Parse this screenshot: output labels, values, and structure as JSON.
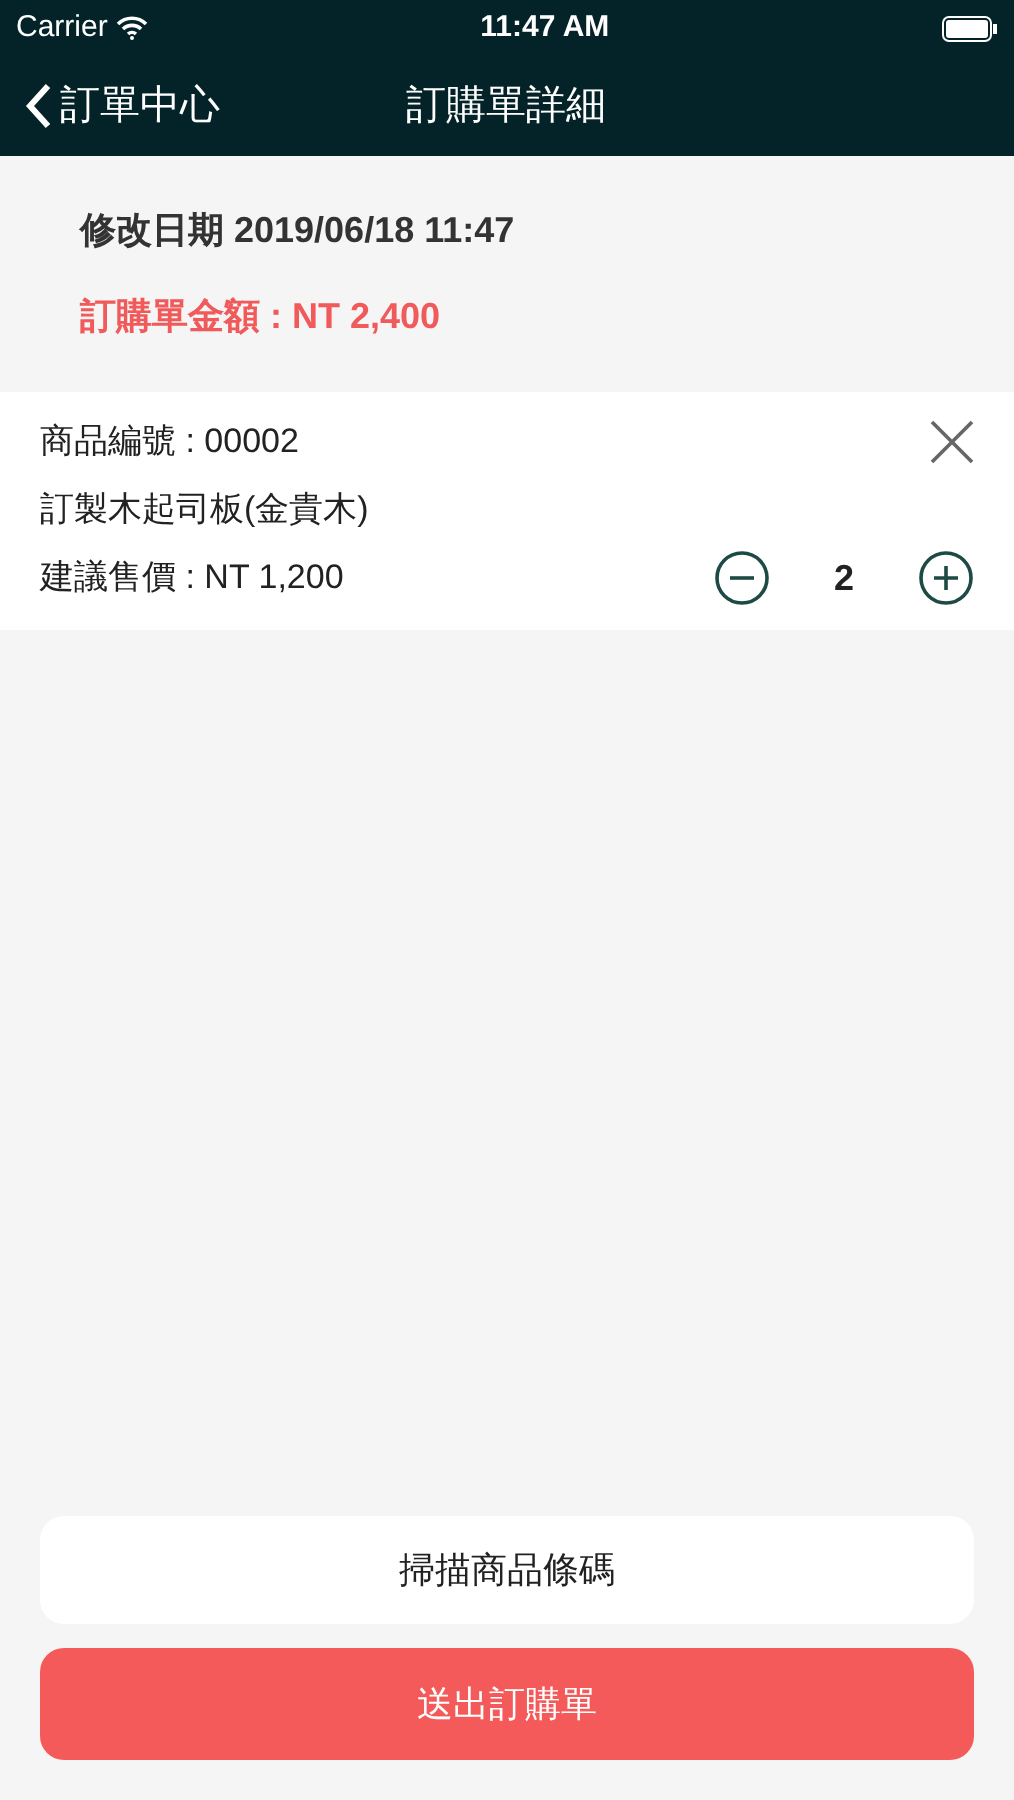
{
  "status_bar": {
    "carrier": "Carrier",
    "time": "11:47 AM"
  },
  "nav": {
    "back": "訂單中心",
    "title": "訂購單詳細"
  },
  "summary": {
    "modified": "修改日期 2019/06/18 11:47",
    "total": "訂購單金額 : NT 2,400"
  },
  "items": [
    {
      "code": "商品編號 : 00002",
      "name": "訂製木起司板(金貴木)",
      "price": "建議售價 : NT 1,200",
      "quantity": "2"
    }
  ],
  "buttons": {
    "scan": "掃描商品條碼",
    "submit": "送出訂購單"
  }
}
